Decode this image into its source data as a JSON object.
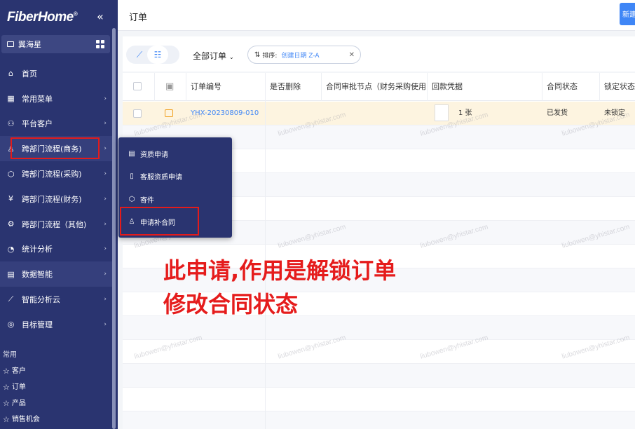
{
  "brand": {
    "logo": "FiberHome",
    "reg": "®",
    "collapse": "«"
  },
  "tenant": {
    "name": "翼海星"
  },
  "sidebar": {
    "items": [
      {
        "label": "首页",
        "icon": "home-icon",
        "glyph": "⌂",
        "arrow": ""
      },
      {
        "label": "常用菜单",
        "icon": "grid-icon",
        "glyph": "▦",
        "arrow": "›"
      },
      {
        "label": "平台客户",
        "icon": "users-icon",
        "glyph": "⚇",
        "arrow": "›"
      },
      {
        "label": "跨部门流程(商务)",
        "icon": "stamp-icon",
        "glyph": "♙",
        "arrow": "›"
      },
      {
        "label": "跨部门流程(采购)",
        "icon": "cube-icon",
        "glyph": "⬡",
        "arrow": "›"
      },
      {
        "label": "跨部门流程(财务)",
        "icon": "yen-icon",
        "glyph": "¥",
        "arrow": "›"
      },
      {
        "label": "跨部门流程（其他)",
        "icon": "gear-icon",
        "glyph": "⚙",
        "arrow": "›"
      },
      {
        "label": "统计分析",
        "icon": "pie-icon",
        "glyph": "◔",
        "arrow": "›"
      },
      {
        "label": "数据智能",
        "icon": "report-icon",
        "glyph": "▤",
        "arrow": "›"
      },
      {
        "label": "智能分析云",
        "icon": "chart-line-icon",
        "glyph": "⟋",
        "arrow": "›"
      },
      {
        "label": "目标管理",
        "icon": "target-icon",
        "glyph": "◎",
        "arrow": "›"
      }
    ]
  },
  "common": {
    "heading": "常用",
    "items": [
      {
        "label": "客户",
        "star": "☆"
      },
      {
        "label": "订单",
        "star": "☆"
      },
      {
        "label": "产品",
        "star": "☆"
      },
      {
        "label": "销售机会",
        "star": "☆"
      }
    ]
  },
  "topbar": {
    "title": "订单",
    "new_label": "新建"
  },
  "toolbar": {
    "view_chart_glyph": "⟋",
    "view_list_glyph": "☷",
    "filter_label": "全部订单",
    "filter_caret": "⌄",
    "sort_icon": "⇅",
    "sort_label": "排序:",
    "sort_value": "创建日期 Z-A",
    "clear": "✕"
  },
  "table": {
    "columns": [
      "订单编号",
      "是否删除",
      "合同审批节点（财务采购使用",
      "回款凭据",
      "合同状态",
      "锁定状态"
    ],
    "header_icon_glyph": "▣",
    "rows": [
      {
        "order_no": "YHX-20230809-010",
        "deleted": "",
        "approval_node": "",
        "receipt": "1 张",
        "status": "已发货",
        "lock": "未锁定"
      }
    ]
  },
  "popup": {
    "items": [
      {
        "label": "资质申请",
        "icon": "form-icon",
        "glyph": "▤"
      },
      {
        "label": "客服资质申请",
        "icon": "doc-icon",
        "glyph": "▯"
      },
      {
        "label": "寄件",
        "icon": "box-icon",
        "glyph": "⬡"
      },
      {
        "label": "申请补合同",
        "icon": "stamp-icon",
        "glyph": "♙"
      }
    ]
  },
  "annotation": {
    "line1": "此申请,作用是解锁订单",
    "line2": "修改合同状态"
  },
  "watermark": "liubowen@yhistar.com",
  "colors": {
    "sidebar": "#2a3470",
    "accent": "#3f86f6",
    "highlight_row": "#fdf4e0",
    "annotation_red": "#e51c1c"
  }
}
